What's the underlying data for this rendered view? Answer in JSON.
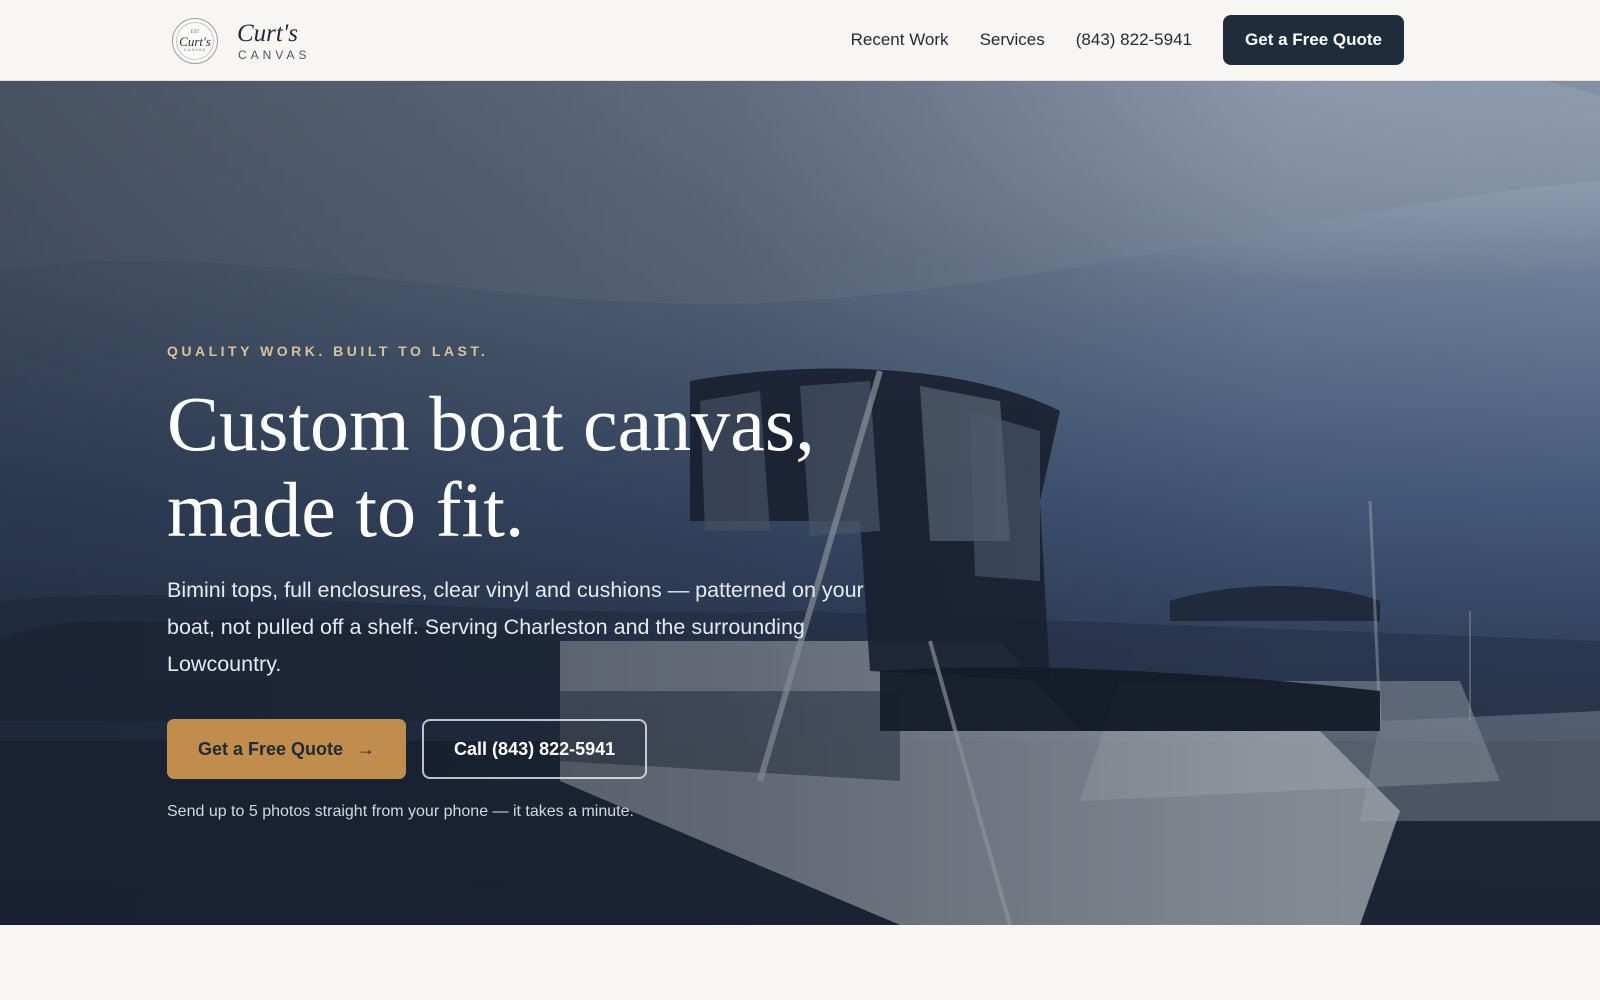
{
  "header": {
    "brand": {
      "seal_top": "EST",
      "seal_main": "Curt's",
      "seal_sub": "CANVAS",
      "name": "Curt's",
      "tagline": "CANVAS"
    },
    "nav": {
      "recent_work": "Recent Work",
      "services": "Services",
      "phone": "(843) 822-5941",
      "cta": "Get a Free Quote"
    }
  },
  "hero": {
    "eyebrow": "QUALITY WORK. BUILT TO LAST.",
    "title": "Custom boat canvas, made to fit.",
    "lede": "Bimini tops, full enclosures, clear vinyl and cushions — patterned on your boat, not pulled off a shelf. Serving Charleston and the surrounding Lowcountry.",
    "primary_cta": "Get a Free Quote",
    "primary_cta_icon": "arrow-right-icon",
    "secondary_cta": "Call (843) 822-5941",
    "note": "Send up to 5 photos straight from your phone — it takes a minute."
  },
  "colors": {
    "navy": "#1f2d3b",
    "accent": "#c08d4c",
    "eyebrow": "#d8c29a",
    "page_bg": "#f8f6f2"
  }
}
